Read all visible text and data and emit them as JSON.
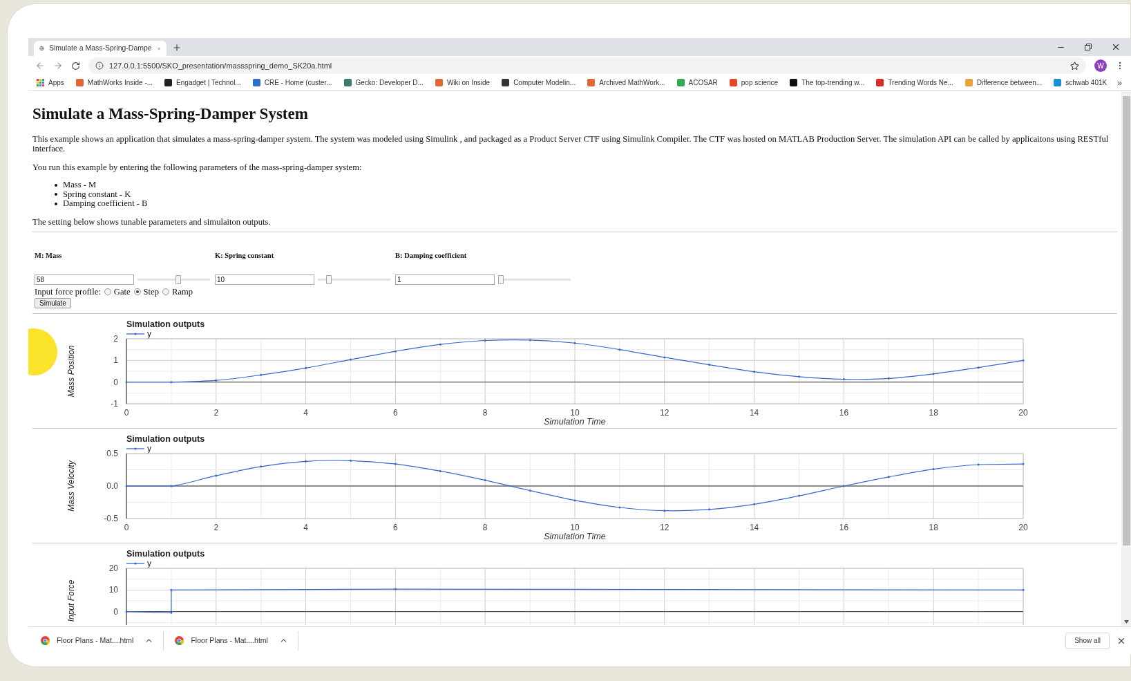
{
  "browser": {
    "tab": {
      "title": "Simulate a Mass-Spring-Dampe",
      "selected": true
    },
    "address": "127.0.0.1:5500/SKO_presentation/massspring_demo_SK20a.html",
    "profile_initial": "W",
    "bookmarks": [
      {
        "label": "Apps"
      },
      {
        "label": "MathWorks Inside -..."
      },
      {
        "label": "Engadget | Technol..."
      },
      {
        "label": "CRE - Home (custer..."
      },
      {
        "label": "Gecko: Developer D..."
      },
      {
        "label": "Wiki on Inside"
      },
      {
        "label": "Computer Modelin..."
      },
      {
        "label": "Archived MathWork..."
      },
      {
        "label": "ACOSAR"
      },
      {
        "label": "pop science"
      },
      {
        "label": "The top-trending w..."
      },
      {
        "label": "Trending Words Ne..."
      },
      {
        "label": "Difference between..."
      },
      {
        "label": "schwab 401K"
      }
    ],
    "bookmarks_overflow": "»"
  },
  "page": {
    "title": "Simulate a Mass-Spring-Damper System",
    "intro": "This example shows an application that simulates a mass-spring-damper system. The system was modeled using Simulink , and packaged as a Product Server CTF using Simulink Compiler. The CTF was hosted on MATLAB Production Server. The simulation API can be called by applicaitons using RESTful interface.",
    "instructions": "You run this example by entering the following parameters of the mass-spring-damper system:",
    "parameters_list": [
      "Mass - M",
      "Spring constant - K",
      "Damping coefficient - B"
    ],
    "setting_note": "The setting below shows tunable parameters and simulaiton outputs.",
    "parameters": [
      {
        "label": "M: Mass",
        "value": "58",
        "level": 0.57
      },
      {
        "label": "K: Spring constant",
        "value": "10",
        "level": 0.12
      },
      {
        "label": "B: Damping coefficient",
        "value": "1",
        "level": 0
      }
    ],
    "force_profile": {
      "label": "Input force profile:",
      "options": [
        {
          "label": "Gate",
          "selected": false
        },
        {
          "label": "Step",
          "selected": true
        },
        {
          "label": "Ramp",
          "selected": false
        }
      ]
    },
    "simulate_button": "Simulate",
    "charts": [
      {
        "chart_data": {
          "type": "line",
          "grid": true,
          "title": "Simulation outputs",
          "xlabel": "Simulation Time",
          "ylabel": "Mass Position",
          "x": [
            0,
            1,
            2,
            3,
            4,
            5,
            6,
            7,
            8,
            9,
            10,
            11,
            12,
            13,
            14,
            15,
            16,
            17,
            18,
            19,
            20
          ],
          "xlim": [
            0,
            20
          ],
          "ylim": [
            -1,
            2
          ],
          "xticks": [
            0,
            2,
            4,
            6,
            8,
            10,
            12,
            14,
            16,
            18,
            20
          ],
          "yticks": [
            -1,
            0,
            1,
            2
          ],
          "series": [
            {
              "name": "y",
              "color": "#3366cc",
              "values": [
                0,
                0,
                0.08,
                0.33,
                0.65,
                1.04,
                1.42,
                1.74,
                1.92,
                1.94,
                1.8,
                1.5,
                1.14,
                0.8,
                0.48,
                0.25,
                0.13,
                0.17,
                0.38,
                0.67,
                1.0
              ]
            }
          ]
        }
      },
      {
        "chart_data": {
          "type": "line",
          "grid": true,
          "title": "Simulation outputs",
          "xlabel": "Simulation Time",
          "ylabel": "Mass Velocity",
          "x": [
            0,
            1,
            2,
            3,
            4,
            5,
            6,
            7,
            8,
            9,
            10,
            11,
            12,
            13,
            14,
            15,
            16,
            17,
            18,
            19,
            20
          ],
          "xlim": [
            0,
            20
          ],
          "ylim": [
            -0.5,
            0.5
          ],
          "xticks": [
            0,
            2,
            4,
            6,
            8,
            10,
            12,
            14,
            16,
            18,
            20
          ],
          "yticks": [
            {
              "value": -0.5,
              "label": "-0.5"
            },
            {
              "value": 0,
              "label": "0.0"
            },
            {
              "value": 0.5,
              "label": "0.5"
            }
          ],
          "series": [
            {
              "name": "y",
              "color": "#3366cc",
              "values": [
                0,
                0,
                0.16,
                0.3,
                0.38,
                0.39,
                0.34,
                0.23,
                0.09,
                -0.07,
                -0.22,
                -0.33,
                -0.38,
                -0.36,
                -0.28,
                -0.15,
                0,
                0.14,
                0.26,
                0.33,
                0.34
              ]
            }
          ]
        }
      },
      {
        "chart_data": {
          "type": "line",
          "grid": true,
          "title": "Simulation outputs",
          "ylabel": "Input Force",
          "x": [
            0,
            1,
            1,
            6,
            20
          ],
          "xlim": [
            0,
            20
          ],
          "ylim": [
            -10,
            20
          ],
          "yticks": [
            0,
            10,
            20
          ],
          "series": [
            {
              "name": "y",
              "color": "#3366cc",
              "values": [
                0,
                -0.5,
                10,
                10.4,
                10
              ]
            }
          ]
        }
      }
    ]
  },
  "downloads": [
    {
      "name": "Floor Plans - Mat....html"
    },
    {
      "name": "Floor Plans - Mat....html"
    }
  ],
  "show_all": "Show all"
}
